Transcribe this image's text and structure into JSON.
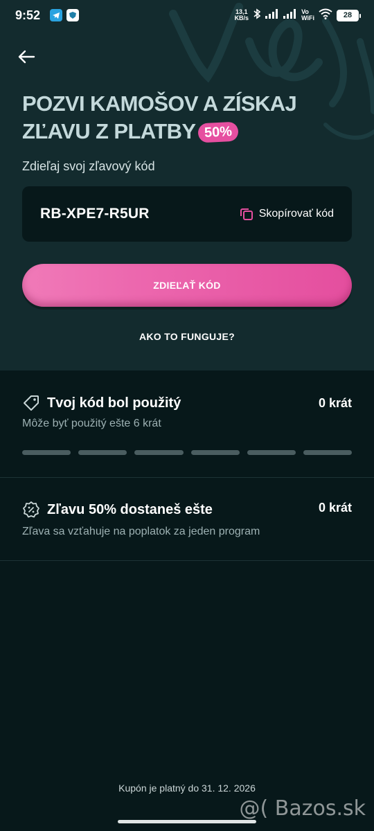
{
  "status_bar": {
    "time": "9:52",
    "net_speed_value": "13,1",
    "net_speed_unit": "KB/s",
    "vowifi_top": "Vo",
    "vowifi_bottom": "WiFi",
    "battery": "28"
  },
  "header": {
    "title": "POZVI KAMOŠOV A ZÍSKAJ ZĽAVU Z PLATBY",
    "badge": "50%"
  },
  "share": {
    "label": "Zdieľaj svoj zľavový kód",
    "code": "RB-XPE7-R5UR",
    "copy_label": "Skopírovať kód",
    "cta_label": "ZDIEĽAŤ KÓD",
    "how_link": "AKO TO FUNGUJE?"
  },
  "usage": {
    "title": "Tvoj kód bol použitý",
    "count": "0 krát",
    "subtitle": "Môže byť použitý ešte 6 krát",
    "segments_used": 0,
    "segments_total": 6
  },
  "discount": {
    "title": "Zľavu 50% dostaneš ešte",
    "count": "0 krát",
    "subtitle": "Zľava sa vzťahuje na poplatok za jeden program"
  },
  "footer": {
    "validity": "Kupón je platný do 31. 12. 2026"
  },
  "watermark": "@( Bazos.sk",
  "colors": {
    "accent_pink": "#e64fa0",
    "top_background": "#132b2e",
    "page_background": "#07181a"
  }
}
